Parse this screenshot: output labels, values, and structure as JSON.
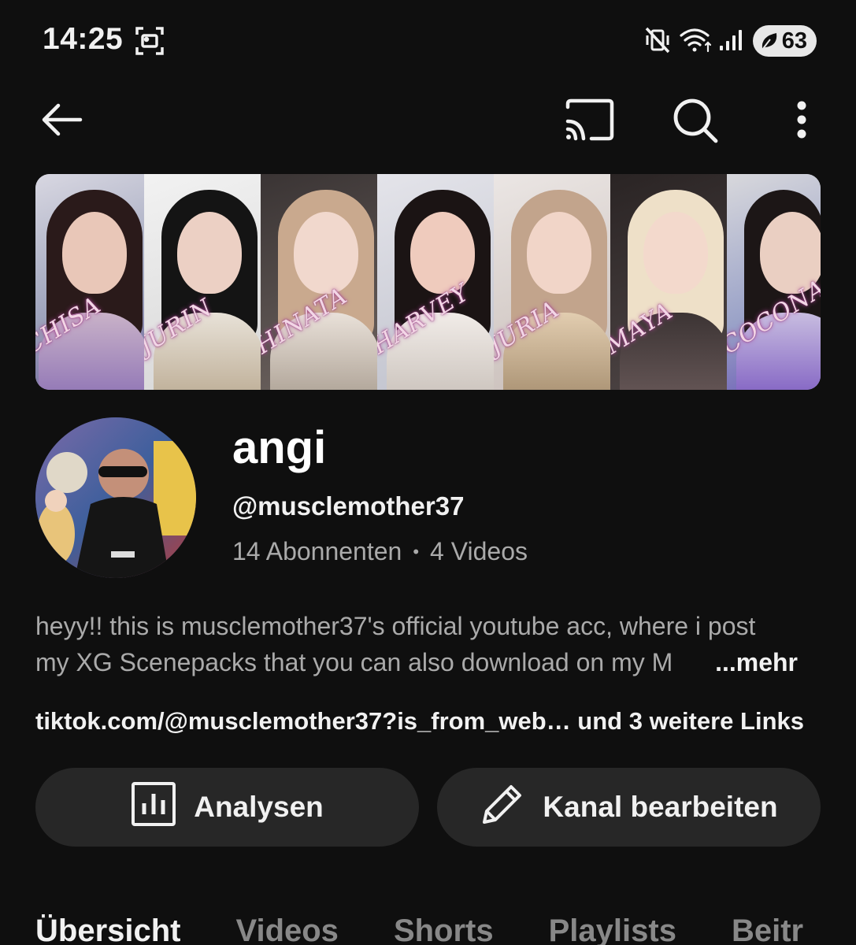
{
  "status_bar": {
    "time": "14:25",
    "battery": "63",
    "icons": [
      "screenshot-icon",
      "vibrate-mute-icon",
      "wifi-icon",
      "signal-icon",
      "battery-saver-icon"
    ]
  },
  "app_bar": {
    "icons": [
      "back-arrow-icon",
      "cast-icon",
      "search-icon",
      "more-vert-icon"
    ]
  },
  "banner": {
    "members": [
      "CHISA",
      "JURIN",
      "HINATA",
      "HARVEY",
      "JURIA",
      "MAYA",
      "COCONA"
    ]
  },
  "channel": {
    "name": "angi",
    "handle": "@musclemother37",
    "subscribers": "14 Abonnenten",
    "separator": "•",
    "videos": "4 Videos",
    "description_line1": "heyy!! this is musclemother37's official youtube acc, where i post",
    "description_line2": "my XG Scenepacks that you can also download on my M",
    "more_label": "...mehr",
    "links_text": "tiktok.com/@musclemother37?is_from_web… und 3 weitere Links"
  },
  "actions": {
    "analytics_label": "Analysen",
    "edit_label": "Kanal bearbeiten"
  },
  "tabs": [
    "Übersicht",
    "Videos",
    "Shorts",
    "Playlists",
    "Beitr"
  ],
  "colors": {
    "background": "#0f0f0f",
    "button_bg": "#272727",
    "secondary_text": "#aaaaaa"
  }
}
